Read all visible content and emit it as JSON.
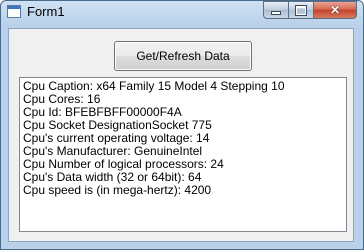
{
  "window": {
    "title": "Form1",
    "icon": "form-app-icon",
    "controls": {
      "minimize_icon": "minimize-icon",
      "maximize_icon": "maximize-icon",
      "close_icon": "close-icon",
      "close_glyph": "✕"
    }
  },
  "main": {
    "button_label": "Get/Refresh Data",
    "output_lines": [
      "Cpu Caption: x64 Family 15 Model 4 Stepping 10",
      "Cpu Cores: 16",
      "Cpu Id: BFEBFBFF00000F4A",
      "Cpu Socket DesignationSocket 775",
      "Cpu's current operating voltage: 14",
      "Cpu's Manufacturer: GenuineIntel",
      "Cpu Number of logical processors: 24",
      "Cpu's Data width (32 or 64bit): 64",
      "Cpu speed is (in mega-hertz): 4200"
    ]
  },
  "colors": {
    "titlebar": "#b9d1ea",
    "client_background": "#f0f0f0",
    "close_button": "#c4412b"
  }
}
